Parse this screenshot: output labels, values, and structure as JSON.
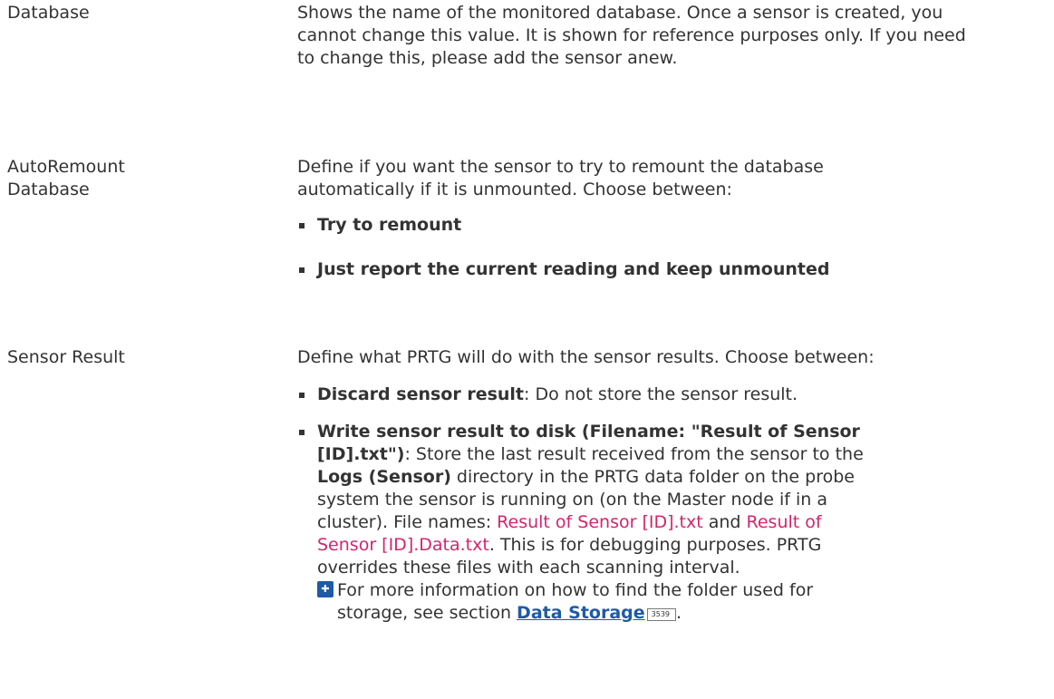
{
  "rows": {
    "database": {
      "label": "Database",
      "description": "Shows the name of the monitored database. Once a sensor is created, you cannot change this value. It is shown for reference purposes only. If you need to change this, please add the sensor anew."
    },
    "auto_remount": {
      "label_line1": "AutoRemount",
      "label_line2": "Database",
      "description": "Define if you want the sensor to try to remount the database automatically if it is unmounted. Choose between:",
      "options": [
        "Try to remount",
        "Just report the current reading and keep unmounted"
      ]
    },
    "sensor_result": {
      "label": "Sensor Result",
      "description": "Define what PRTG will do with the sensor results. Choose between:",
      "option1_title": "Discard sensor result",
      "option1_text": ": Do not store the sensor result.",
      "option2_title": "Write sensor result to disk (Filename: \"Result of Sensor [ID].txt\")",
      "option2_text_a": ": Store the last result received from the sensor to the ",
      "option2_bold": "Logs (Sensor)",
      "option2_text_b": " directory in the PRTG data folder on the probe system the sensor is running on (on the Master node if in a cluster). File names: ",
      "option2_link1": "Result of Sensor [ID].txt",
      "option2_text_c": " and ",
      "option2_link2": "Result of Sensor [ID].Data.txt",
      "option2_text_d": ". This is for debugging purposes. PRTG overrides these files with each scanning interval.",
      "note_text": "For more information on how to find the folder used for storage, see section ",
      "note_link": "Data Storage",
      "note_page": "3539",
      "note_end": "."
    }
  },
  "colors": {
    "text": "#333333",
    "link_pink": "#d6246c",
    "link_blue": "#1f5aa6"
  }
}
